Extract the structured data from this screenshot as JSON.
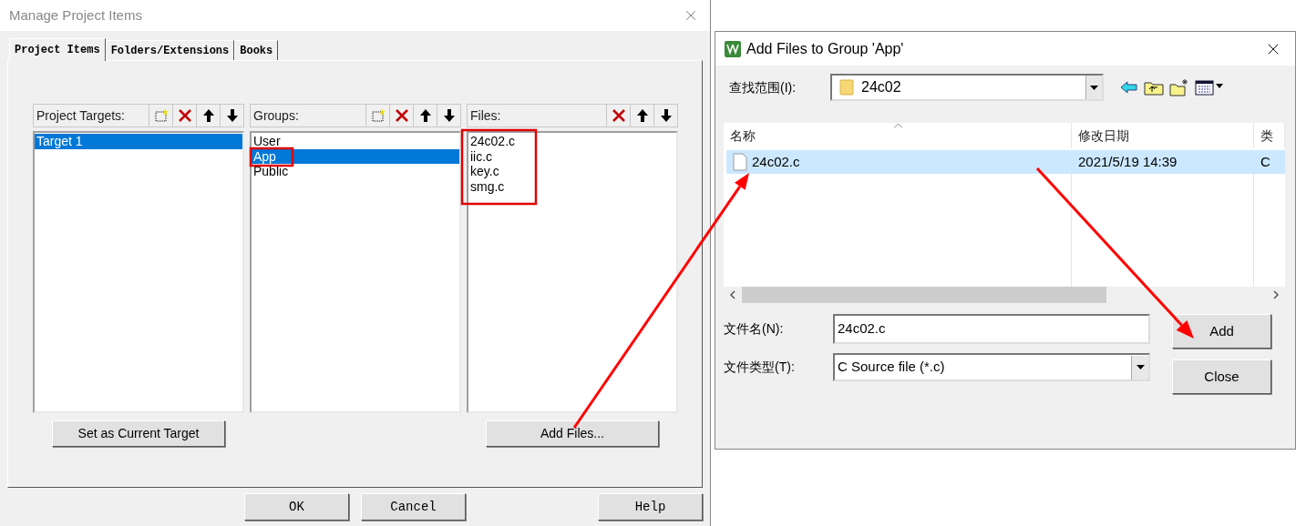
{
  "manage_dialog": {
    "title": "Manage Project Items",
    "tabs": [
      {
        "label": "Project Items",
        "selected": true
      },
      {
        "label": "Folders/Extensions",
        "selected": false
      },
      {
        "label": "Books",
        "selected": false
      }
    ],
    "panels": [
      {
        "label": "Project Targets:",
        "tools": [
          {
            "kind": "new"
          },
          {
            "kind": "delete"
          },
          {
            "kind": "up"
          },
          {
            "kind": "down"
          }
        ],
        "items": [
          {
            "label": "Target 1",
            "selected": true
          }
        ],
        "button": "Set as Current Target"
      },
      {
        "label": "Groups:",
        "tools": [
          {
            "kind": "new"
          },
          {
            "kind": "delete"
          },
          {
            "kind": "up"
          },
          {
            "kind": "down"
          }
        ],
        "items": [
          {
            "label": "User",
            "selected": false
          },
          {
            "label": "App",
            "selected": true
          },
          {
            "label": "Public",
            "selected": false
          }
        ]
      },
      {
        "label": "Files:",
        "tools": [
          {
            "kind": "delete"
          },
          {
            "kind": "up"
          },
          {
            "kind": "down"
          }
        ],
        "items": [
          {
            "label": "24c02.c",
            "selected": false
          },
          {
            "label": "iic.c",
            "selected": false
          },
          {
            "label": "key.c",
            "selected": false
          },
          {
            "label": "smg.c",
            "selected": false
          }
        ],
        "button": "Add Files..."
      }
    ],
    "footer_buttons": [
      "OK",
      "Cancel",
      "Help"
    ]
  },
  "add_files_dialog": {
    "title": "Add Files to Group 'App'",
    "look_in_label": "查找范围(I):",
    "look_in": "24c02",
    "columns": [
      "名称",
      "修改日期",
      "类"
    ],
    "rows": [
      {
        "name": "24c02.c",
        "date": "2021/5/19 14:39",
        "type": "C",
        "selected": true
      }
    ],
    "file_name_label": "文件名(N):",
    "file_name": "24c02.c",
    "file_type_label": "文件类型(T):",
    "file_type": "C Source file (*.c)",
    "buttons": [
      "Add",
      "Close"
    ]
  }
}
